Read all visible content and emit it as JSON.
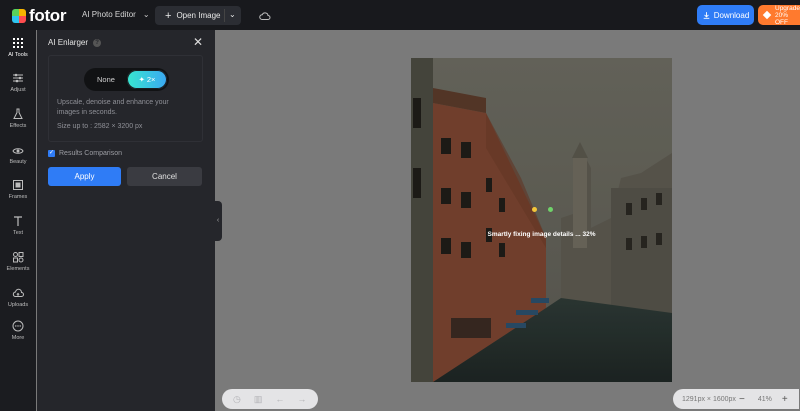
{
  "header": {
    "brand": "fotor",
    "product_label": "AI Photo Editor",
    "open_image_label": "Open Image",
    "download_label": "Download",
    "upgrade_line1": "Upgrade",
    "upgrade_line2": "20% OFF"
  },
  "sidebar": {
    "items": [
      {
        "label": "AI Tools",
        "icon": "grid-icon"
      },
      {
        "label": "Adjust",
        "icon": "sliders-icon"
      },
      {
        "label": "Effects",
        "icon": "flask-icon"
      },
      {
        "label": "Beauty",
        "icon": "eye-icon"
      },
      {
        "label": "Frames",
        "icon": "frame-icon"
      },
      {
        "label": "Text",
        "icon": "text-icon"
      },
      {
        "label": "Elements",
        "icon": "shapes-icon"
      },
      {
        "label": "Uploads",
        "icon": "cloud-upload-icon"
      },
      {
        "label": "More",
        "icon": "more-icon"
      }
    ]
  },
  "panel": {
    "title": "AI Enlarger",
    "toggle_none": "None",
    "toggle_2x": "2×",
    "description": "Upscale, denoise and enhance your images in seconds.",
    "size_limit": "Size up to : 2582 × 3200 px",
    "checkbox_label": "Results Comparison",
    "checkbox_checked": true,
    "apply_label": "Apply",
    "cancel_label": "Cancel"
  },
  "canvas": {
    "progress_text": "Smartly fixing image details ... 32%",
    "progress_percent": 32,
    "image_dimensions": "1291px × 1600px",
    "zoom": "41%"
  },
  "colors": {
    "accent": "#2f7cf6",
    "upgrade": "#ff7a2e",
    "topbar": "#18191d",
    "panel": "#25262b"
  }
}
